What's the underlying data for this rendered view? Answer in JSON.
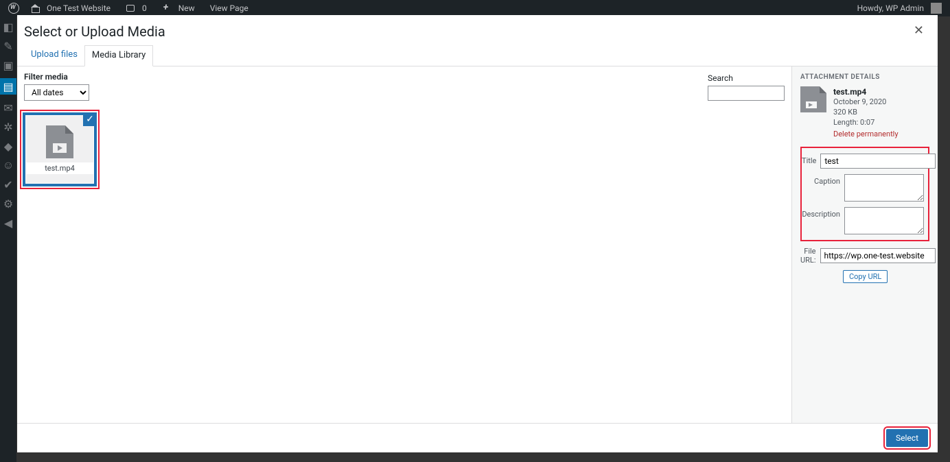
{
  "adminbar": {
    "site_name": "One Test Website",
    "comment_count": "0",
    "new_label": "New",
    "view_page_label": "View Page",
    "howdy": "Howdy, WP Admin"
  },
  "modal": {
    "title": "Select or Upload Media",
    "close_glyph": "✕",
    "tabs": {
      "upload": "Upload files",
      "library": "Media Library"
    },
    "filter_label": "Filter media",
    "filter_value": "All dates",
    "search_label": "Search",
    "search_value": "",
    "item": {
      "filename": "test.mp4"
    },
    "details_heading": "ATTACHMENT DETAILS",
    "attachment": {
      "filename": "test.mp4",
      "date": "October 9, 2020",
      "size": "320 KB",
      "length": "Length: 0:07",
      "delete_label": "Delete permanently"
    },
    "fields": {
      "title_label": "Title",
      "title_value": "test",
      "caption_label": "Caption",
      "caption_value": "",
      "description_label": "Description",
      "description_value": "",
      "fileurl_label": "File URL:",
      "fileurl_value": "https://wp.one-test.website",
      "copy_label": "Copy URL"
    },
    "select_label": "Select"
  }
}
